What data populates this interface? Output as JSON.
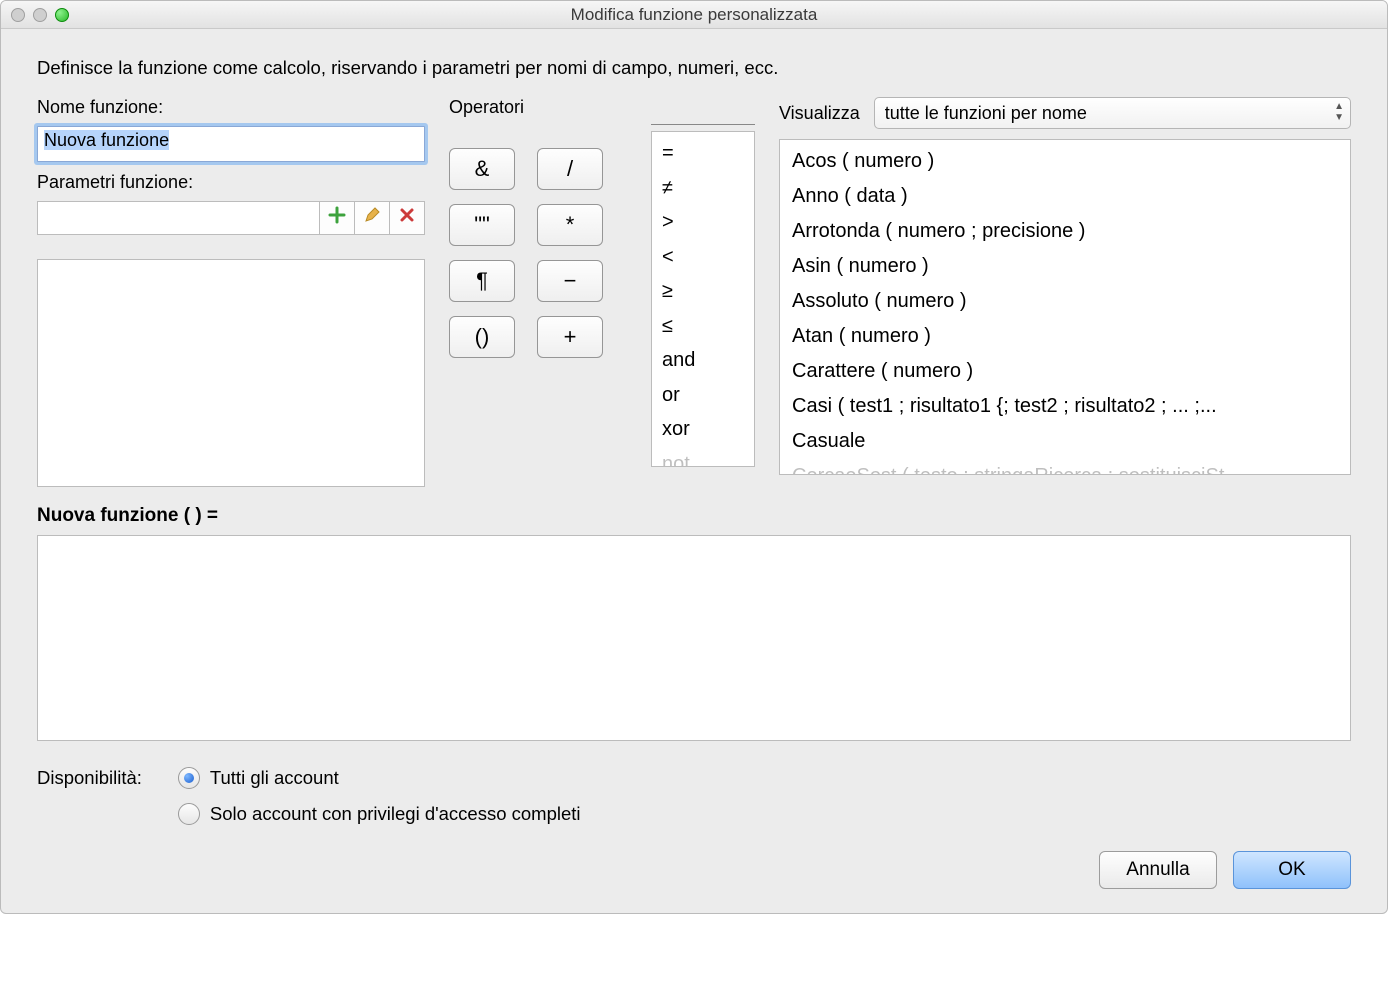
{
  "window": {
    "title": "Modifica funzione personalizzata"
  },
  "description": "Definisce la funzione come calcolo, riservando i parametri per nomi di campo, numeri, ecc.",
  "labels": {
    "function_name": "Nome funzione:",
    "function_params": "Parametri funzione:",
    "operators": "Operatori",
    "view": "Visualizza",
    "availability": "Disponibilità:"
  },
  "function_name_value": "Nuova funzione",
  "parameter_value": "",
  "operator_buttons": [
    "&",
    "/",
    "\"\"",
    "*",
    "¶",
    "−",
    "()",
    "+"
  ],
  "comparison_ops": [
    "=",
    "≠",
    ">",
    "<",
    "≥",
    "≤",
    "and",
    "or",
    "xor",
    "not"
  ],
  "view_dropdown_selected": "tutte le funzioni per nome",
  "functions": [
    "Acos ( numero )",
    "Anno ( data )",
    "Arrotonda ( numero ; precisione )",
    "Asin ( numero )",
    "Assoluto ( numero )",
    "Atan ( numero )",
    "Carattere ( numero )",
    "Casi ( test1 ; risultato1 {; test2 ; risultato2 ; ... ;...",
    "Casuale",
    "CercaeSost ( testo ; stringaRicerca ; sostituisciSt..."
  ],
  "signature": "Nuova funzione (  ) =",
  "calculation": "",
  "availability_options": {
    "all": "Tutti gli account",
    "full": "Solo account con privilegi d'accesso completi"
  },
  "availability_selected": "all",
  "buttons": {
    "cancel": "Annulla",
    "ok": "OK"
  }
}
